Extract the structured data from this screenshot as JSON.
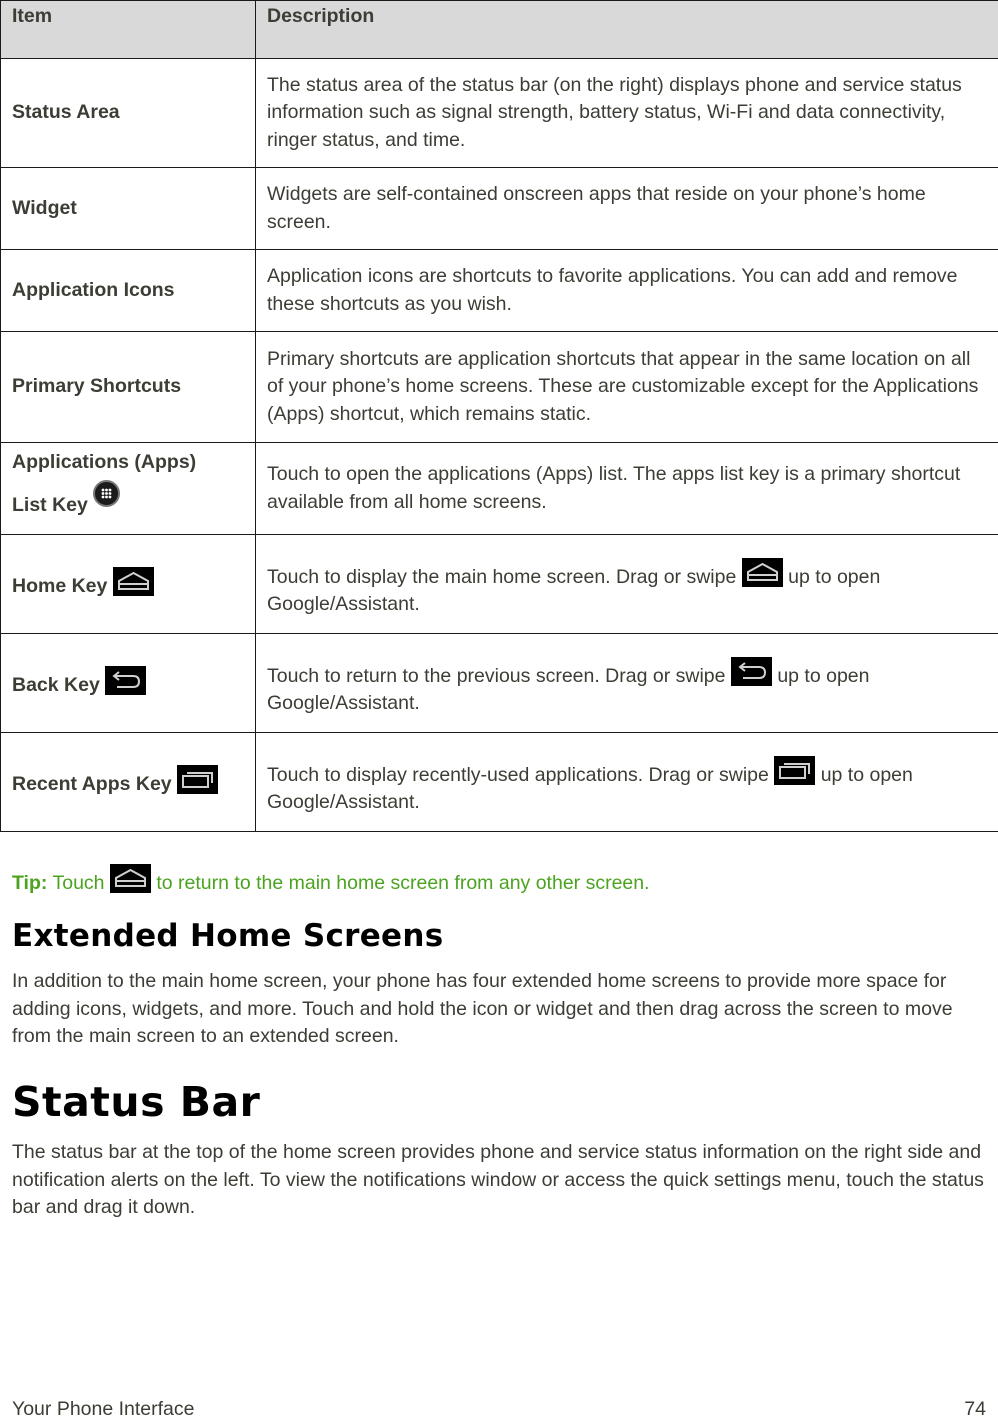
{
  "table": {
    "headers": {
      "item": "Item",
      "description": "Description"
    },
    "rows": [
      {
        "item": "Status Area",
        "description": "The status area of the status bar (on the right) displays phone and service status information such as signal strength, battery status, Wi-Fi and data connectivity, ringer status, and time."
      },
      {
        "item": "Widget",
        "description": "Widgets are self-contained onscreen apps that reside on your phone’s home screen."
      },
      {
        "item": "Application Icons",
        "description": "Application icons are shortcuts to favorite applications. You can add and remove these shortcuts as you wish."
      },
      {
        "item": "Primary Shortcuts",
        "description": "Primary shortcuts are application shortcuts that appear in the same location on all of your phone’s home screens. These are customizable except for the Applications (Apps) shortcut, which remains static."
      },
      {
        "item_line1": "Applications (Apps)",
        "item_line2": "List Key",
        "icon": "apps-list-icon",
        "description": "Touch to open the applications (Apps) list. The apps list key is a primary shortcut available from all home screens."
      },
      {
        "item": "Home Key",
        "icon": "home-key-icon",
        "description_before": "Touch to display the main home screen. Drag or swipe",
        "description_after": "up to open Google/Assistant."
      },
      {
        "item": "Back Key",
        "icon": "back-key-icon",
        "description_before": "Touch to return to the previous screen. Drag or swipe",
        "description_after": "up to open Google/Assistant."
      },
      {
        "item": "Recent Apps Key",
        "icon": "recent-apps-key-icon",
        "description_before": "Touch to display recently-used applications. Drag or swipe",
        "description_after": "up to open Google/Assistant."
      }
    ]
  },
  "tip": {
    "label": "Tip:",
    "before": "Touch",
    "icon": "home-key-icon",
    "after": "to return to the main home screen from any other screen.",
    "color": "#4ba31f"
  },
  "sections": {
    "extended": {
      "heading": "Extended Home Screens",
      "body": "In addition to the main home screen, your phone has four extended home screens to provide more space for adding icons, widgets, and more. Touch and hold the icon or widget and then drag across the screen to move from the main screen to an extended screen."
    },
    "status_bar": {
      "heading": "Status Bar",
      "body": "The status bar at the top of the home screen provides phone and service status information on the right side and notification alerts on the left. To view the notifications window or access the quick settings menu, touch the status bar and drag it down."
    }
  },
  "footer": {
    "section": "Your Phone Interface",
    "page_number": "74"
  }
}
